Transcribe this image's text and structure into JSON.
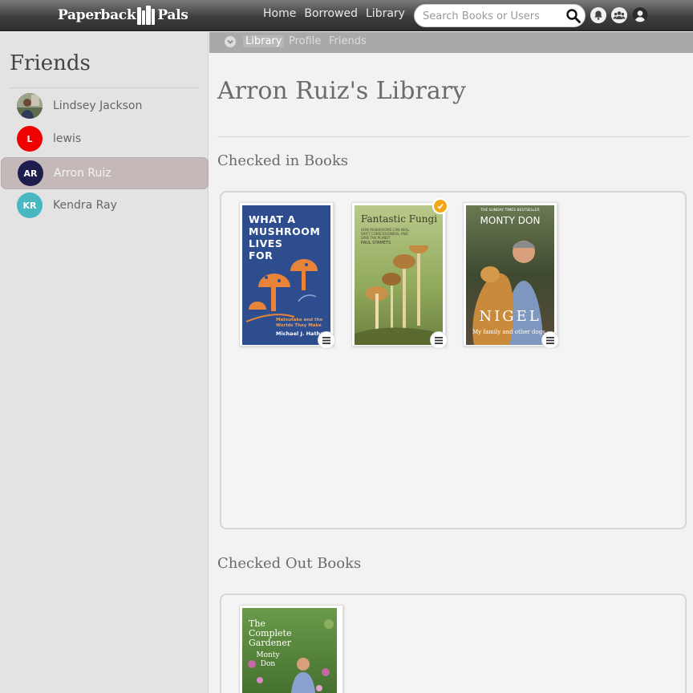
{
  "app": {
    "logo_left": "Paperback",
    "logo_right": "Pals"
  },
  "nav": {
    "home": "Home",
    "borrowed": "Borrowed",
    "library": "Library"
  },
  "search": {
    "placeholder": "Search Books or Users",
    "value": ""
  },
  "icons": {
    "search": "search-icon",
    "notifications": "bell-icon",
    "friends": "friends-icon",
    "profile": "user-icon",
    "subnav_toggle": "chevron-down-icon",
    "book_menu": "menu-icon",
    "checkmark": "check-icon"
  },
  "sidebar": {
    "title": "Friends",
    "friends": [
      {
        "name": "Lindsey Jackson",
        "initials": "",
        "color": "#7b8a6a",
        "has_photo": true,
        "active": false
      },
      {
        "name": "lewis",
        "initials": "L",
        "color": "#f00000",
        "has_photo": false,
        "active": false
      },
      {
        "name": "Arron Ruiz",
        "initials": "AR",
        "color": "#1d1d4e",
        "has_photo": false,
        "active": true
      },
      {
        "name": "Kendra Ray",
        "initials": "KR",
        "color": "#47b8c0",
        "has_photo": false,
        "active": false
      }
    ]
  },
  "subnav": {
    "library": "Library",
    "profile": "Profile",
    "friends": "Friends"
  },
  "main": {
    "title": "Arron Ruiz's Library",
    "checked_in_title": "Checked in Books",
    "checked_out_title": "Checked Out Books"
  },
  "checked_in_books": [
    {
      "title_lines": [
        "WHAT A",
        "MUSHROOM",
        "LIVES",
        "FOR"
      ],
      "subtitle": "Matsutake and the Worlds They Make",
      "author": "Michael J. Hathaway",
      "bg": "#2e4d8e",
      "accent": "#e8843a"
    },
    {
      "title_lines": [
        "Fantastic Fungi"
      ],
      "subtitle": "HOW MUSHROOMS CAN HEAL, SHIFT CONSCIOUSNESS, AND SAVE THE PLANET",
      "author": "PAUL STAMETS",
      "bg": "#9fb36a",
      "accent": "#d9a15a",
      "checked": true
    },
    {
      "title_lines": [
        "MONTY DON"
      ],
      "tagline": "THE SUNDAY TIMES BESTSELLER",
      "big_title": "NIGEL",
      "subtitle": "My family and other dogs",
      "bg": "#4a5a3a",
      "accent": "#c98a3c"
    }
  ],
  "checked_out_books": [
    {
      "title_lines": [
        "The",
        "Complete",
        "Gardener"
      ],
      "author": "Monty Don",
      "bg": "#4f7a3a",
      "accent": "#c667a6"
    }
  ]
}
